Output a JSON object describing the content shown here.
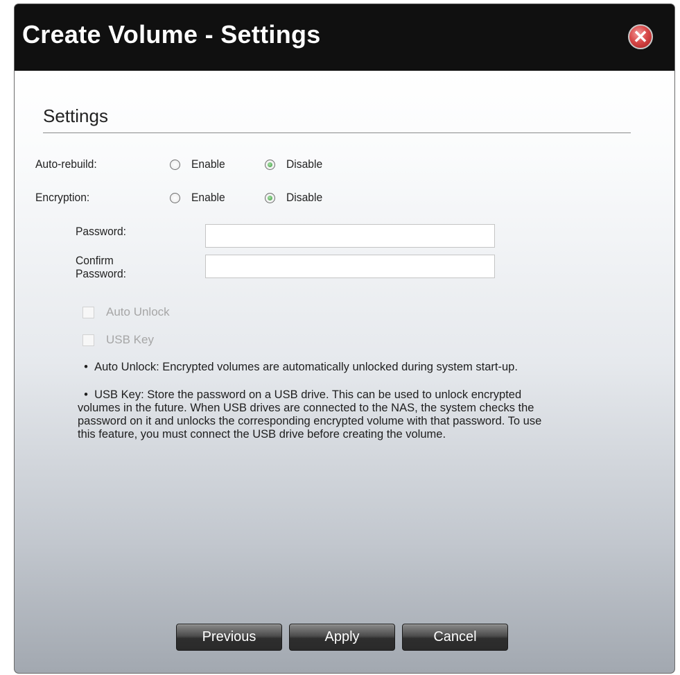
{
  "dialog": {
    "title": "Create Volume - Settings",
    "close_symbol": "✕"
  },
  "settings": {
    "section_title": "Settings",
    "auto_rebuild": {
      "label": "Auto-rebuild:",
      "enable_label": "Enable",
      "disable_label": "Disable",
      "selected": "Disable"
    },
    "encryption": {
      "label": "Encryption:",
      "enable_label": "Enable",
      "disable_label": "Disable",
      "selected": "Disable"
    },
    "password": {
      "label": "Password:",
      "value": ""
    },
    "confirm_password": {
      "label_line1": "Confirm",
      "label_line2": "Password:",
      "value": ""
    },
    "auto_unlock": {
      "label": "Auto Unlock",
      "checked": false,
      "disabled": true
    },
    "usb_key": {
      "label": "USB Key",
      "checked": false,
      "disabled": true
    },
    "notes": {
      "auto_unlock": "Auto Unlock: Encrypted volumes are automatically unlocked during system start-up.",
      "usb_key": "USB Key: Store the password on a USB drive. This can be used to unlock encrypted volumes in the future. When USB drives are connected to the NAS, the system checks the password on it and unlocks the corresponding encrypted volume with that password. To use this feature, you must connect the USB drive before creating the volume."
    }
  },
  "buttons": {
    "previous": "Previous",
    "apply": "Apply",
    "cancel": "Cancel"
  },
  "icons": {
    "close": "close-icon"
  }
}
